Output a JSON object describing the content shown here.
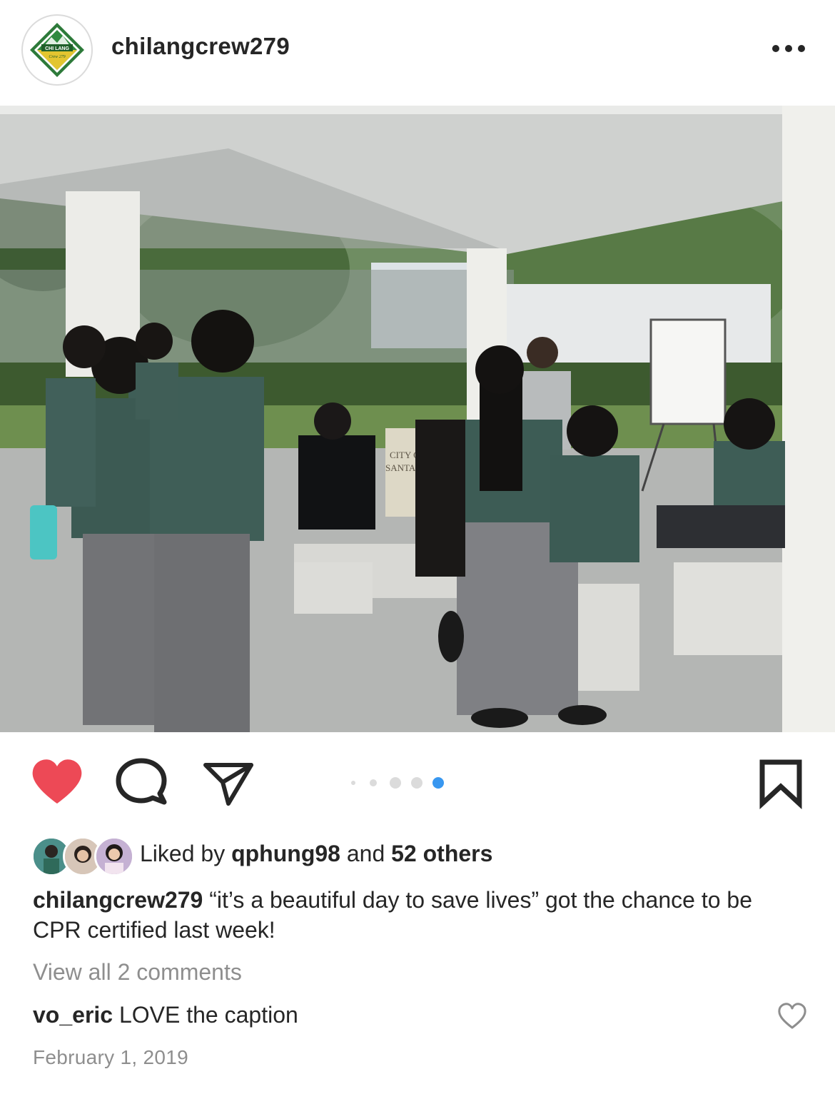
{
  "post": {
    "username": "chilangcrew279",
    "avatar_logo_text": [
      "CHI LANG",
      "Crew 279"
    ],
    "more_icon": "more-horizontal-icon",
    "photo": {
      "sign_text": [
        "CITY O",
        "SANTA"
      ],
      "description_alt": ""
    },
    "actions": {
      "like_icon": "heart-filled-icon",
      "comment_icon": "comment-icon",
      "share_icon": "paper-plane-icon",
      "save_icon": "bookmark-icon",
      "like_color": "#ed4956"
    },
    "carousel": {
      "total": 5,
      "active_index": 4,
      "active_color": "#3897f0"
    },
    "likes": {
      "prefix": "Liked by",
      "user": "qphung98",
      "joiner": "and",
      "others": "52 others"
    },
    "caption": {
      "username": "chilangcrew279",
      "text": "“it’s a beautiful day to save lives” got the chance to be CPR certified last week!"
    },
    "view_all_comments": "View all 2 comments",
    "comments": [
      {
        "username": "vo_eric",
        "text": "LOVE the caption",
        "like_icon": "heart-outline-icon"
      }
    ],
    "date": "February 1, 2019"
  }
}
